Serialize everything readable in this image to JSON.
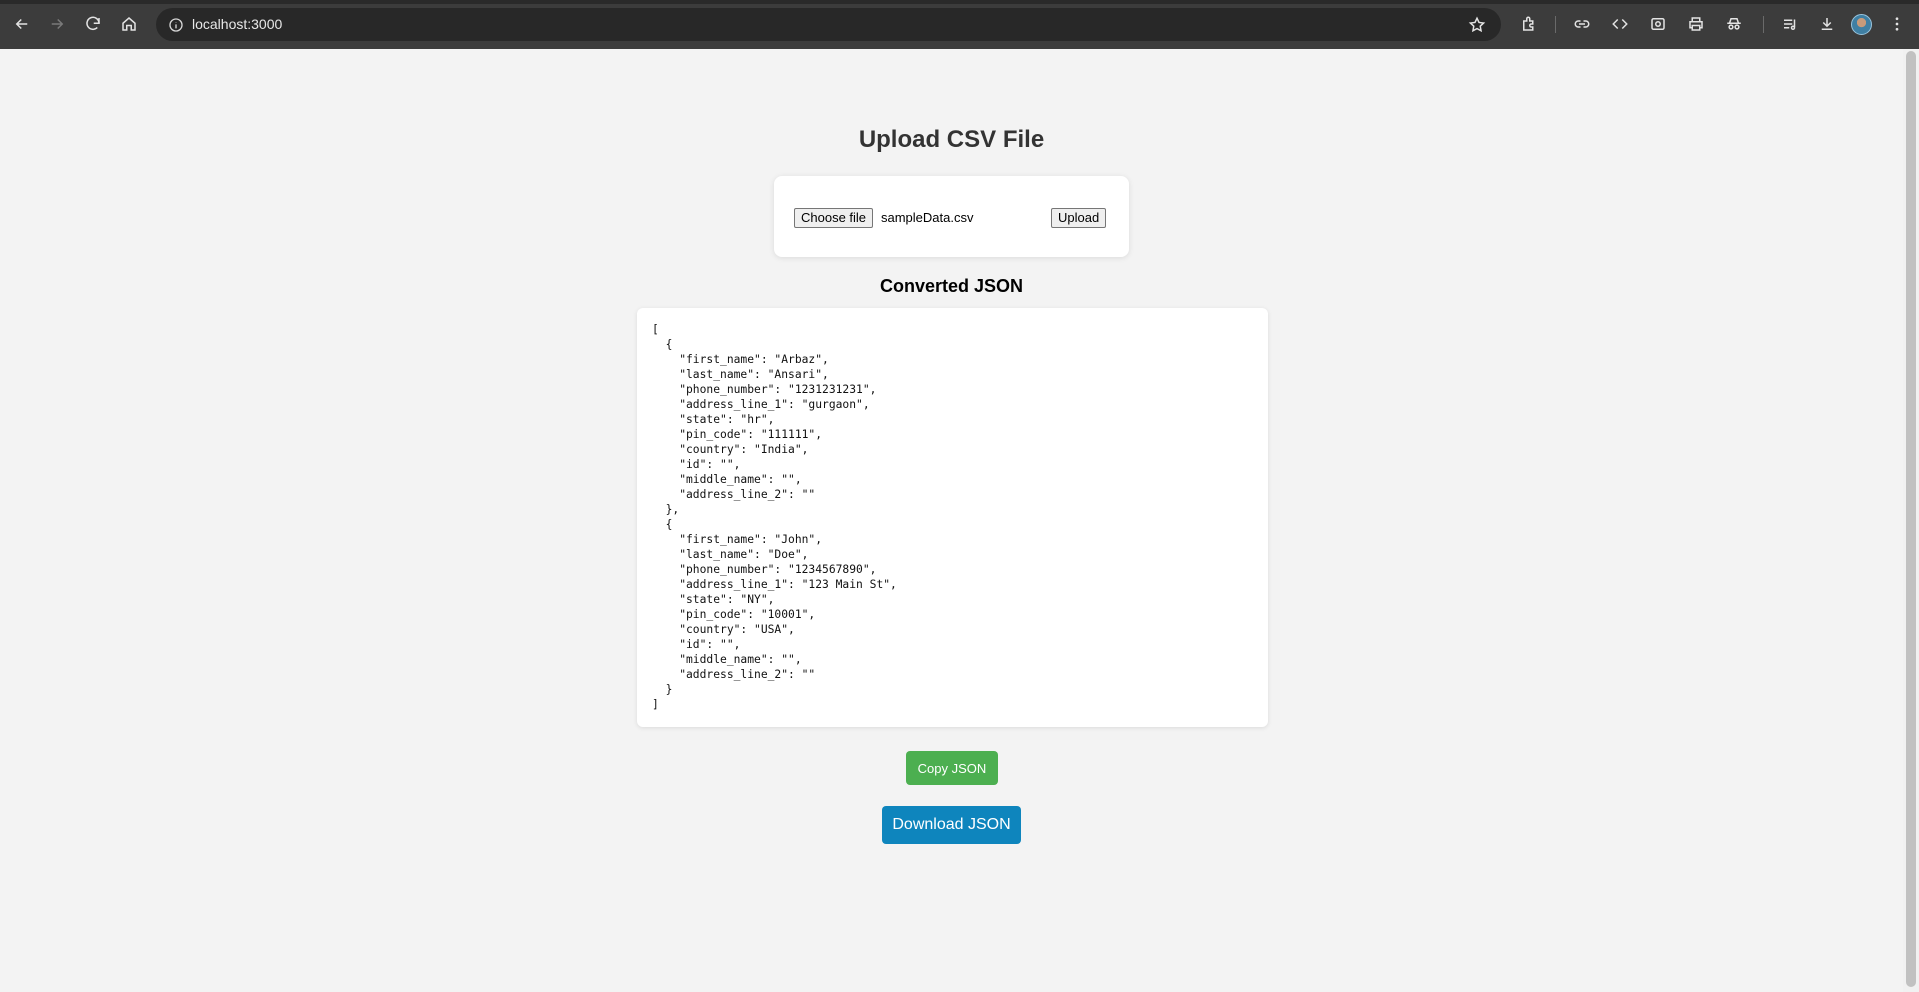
{
  "browser": {
    "url": "localhost:3000"
  },
  "page": {
    "title": "Upload CSV File",
    "upload": {
      "choose_label": "Choose file",
      "file_name": "sampleData.csv",
      "upload_label": "Upload"
    },
    "converted_title": "Converted JSON",
    "json_text": "[\n  {\n    \"first_name\": \"Arbaz\",\n    \"last_name\": \"Ansari\",\n    \"phone_number\": \"1231231231\",\n    \"address_line_1\": \"gurgaon\",\n    \"state\": \"hr\",\n    \"pin_code\": \"111111\",\n    \"country\": \"India\",\n    \"id\": \"\",\n    \"middle_name\": \"\",\n    \"address_line_2\": \"\"\n  },\n  {\n    \"first_name\": \"John\",\n    \"last_name\": \"Doe\",\n    \"phone_number\": \"1234567890\",\n    \"address_line_1\": \"123 Main St\",\n    \"state\": \"NY\",\n    \"pin_code\": \"10001\",\n    \"country\": \"USA\",\n    \"id\": \"\",\n    \"middle_name\": \"\",\n    \"address_line_2\": \"\"\n  }\n]",
    "copy_label": "Copy JSON",
    "download_label": "Download JSON"
  },
  "colors": {
    "copy_button": "#4caf50",
    "download_button": "#0e85bd",
    "page_background": "#f3f3f3"
  },
  "icons": {
    "toolbar": [
      "back-icon",
      "forward-icon",
      "reload-icon",
      "home-icon",
      "site-info-icon",
      "bookmark-star-icon",
      "extensions-icon",
      "link-icon",
      "code-icon",
      "screenshot-icon",
      "print-icon",
      "incognito-icon",
      "media-queue-icon",
      "download-icon",
      "profile-avatar",
      "menu-icon"
    ]
  }
}
